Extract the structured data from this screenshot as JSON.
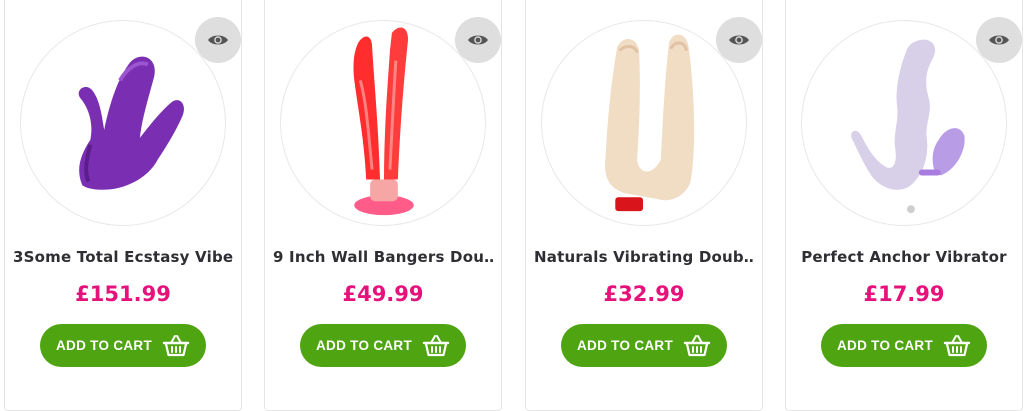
{
  "products": [
    {
      "title": "3Some Total Ecstasy Vibe",
      "price": "£151.99",
      "image": "purple-triple-vibrator",
      "quickview_icon": "eye-icon"
    },
    {
      "title": "9 Inch Wall Bangers Dou…",
      "price": "£49.99",
      "image": "red-double-dildo",
      "quickview_icon": "eye-icon"
    },
    {
      "title": "Naturals Vibrating Doub…",
      "price": "£32.99",
      "image": "flesh-double-vibrator",
      "quickview_icon": "eye-icon"
    },
    {
      "title": "Perfect Anchor Vibrator",
      "price": "£17.99",
      "image": "lilac-anchor-vibrator",
      "quickview_icon": "eye-icon"
    }
  ],
  "add_to_cart_label": "ADD TO CART",
  "colors": {
    "price": "#e6127b",
    "button": "#4fa412",
    "title": "#2e2e33",
    "quickview_bg": "#dedede"
  }
}
